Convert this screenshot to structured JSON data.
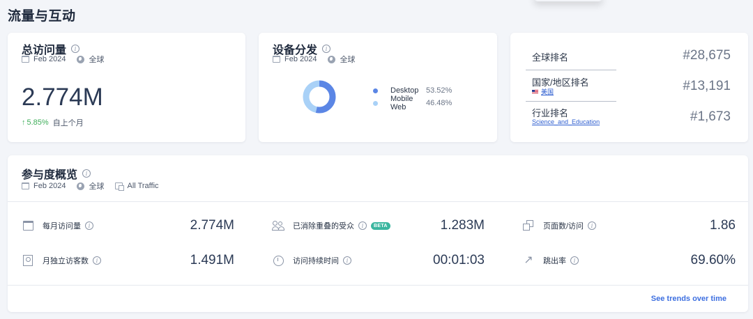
{
  "page": {
    "title": "流量与互动"
  },
  "visits_card": {
    "title": "总访问量",
    "date": "Feb 2024",
    "region": "全球",
    "value": "2.774M",
    "change": "5.85%",
    "change_label": "自上个月",
    "colors": {
      "positive": "#3fae5a"
    }
  },
  "device_card": {
    "title": "设备分发",
    "date": "Feb 2024",
    "region": "全球",
    "segments": [
      {
        "name": "Desktop",
        "percent": "53.52%",
        "value": 53.52,
        "color": "#5b86e5"
      },
      {
        "name": "Mobile Web",
        "percent": "46.48%",
        "value": 46.48,
        "color": "#a9d1f7"
      }
    ]
  },
  "rank_card": {
    "global": {
      "label": "全球排名",
      "value": "#28,675"
    },
    "country": {
      "label": "国家/地区排名",
      "sub": "美国",
      "value": "#13,191"
    },
    "industry": {
      "label": "行业排名",
      "sub": "Science_and_Education",
      "value": "#1,673"
    }
  },
  "engagement_card": {
    "title": "参与度概览",
    "date": "Feb 2024",
    "region": "全球",
    "traffic": "All Traffic",
    "metrics": {
      "monthly_visits": {
        "label": "每月访问量",
        "value": "2.774M",
        "icon": "calendar-icon"
      },
      "dedup_audience": {
        "label": "已消除重叠的受众",
        "badge": "BETA",
        "value": "1.283M",
        "icon": "people-icon"
      },
      "pages_per_visit": {
        "label": "页面数/访问",
        "value": "1.86",
        "icon": "pages-icon"
      },
      "unique_visitors": {
        "label": "月独立访客数",
        "value": "1.491M",
        "icon": "user-card-icon"
      },
      "visit_duration": {
        "label": "访问持续时间",
        "value": "00:01:03",
        "icon": "timer-icon"
      },
      "bounce_rate": {
        "label": "跳出率",
        "value": "69.60%",
        "icon": "bounce-arrow-icon"
      }
    },
    "trends_link": "See trends over time",
    "colors": {
      "beta": "#3bb6a0",
      "link": "#3d6fe0"
    }
  }
}
